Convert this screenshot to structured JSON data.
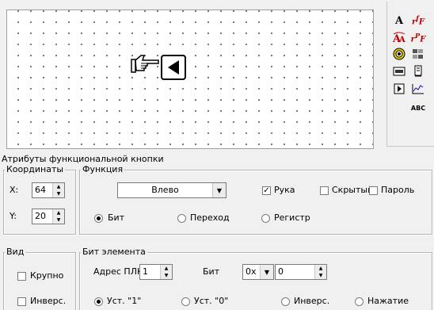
{
  "panel": {
    "title": "Атрибуты функциональной кнопки",
    "coords": {
      "legend": "Координаты",
      "x_label": "X:",
      "x_value": "64",
      "y_label": "Y:",
      "y_value": "20"
    },
    "function": {
      "legend": "Функция",
      "selected": "Влево",
      "hand_label": "Рука",
      "hand_checked": true,
      "hidden_label": "Скрытый",
      "password_label": "Пароль",
      "radio_bit": "Бит",
      "radio_jump": "Переход",
      "radio_register": "Регистр"
    },
    "view": {
      "legend": "Вид",
      "large_label": "Крупно",
      "invert_label": "Инверс."
    },
    "element_bit": {
      "legend": "Бит элемента",
      "plc_addr_label": "Адрес ПЛК",
      "plc_addr_value": "1",
      "bit_label": "Бит",
      "prefix_value": "0x",
      "bit_value": "0",
      "opt_set1": "Уст. \"1\"",
      "opt_set0": "Уст. \"0\"",
      "opt_invert": "Инверс.",
      "opt_press": "Нажатие"
    }
  },
  "toolbar": {
    "icons": [
      "text-icon",
      "font-style-icon",
      "font-size-icon",
      "font-color-icon",
      "lamp-icon",
      "image-icon",
      "keyboard-icon",
      "meter-icon",
      "function-button-icon",
      "trend-icon",
      "abc-icon"
    ],
    "abc_text": "ABC"
  }
}
